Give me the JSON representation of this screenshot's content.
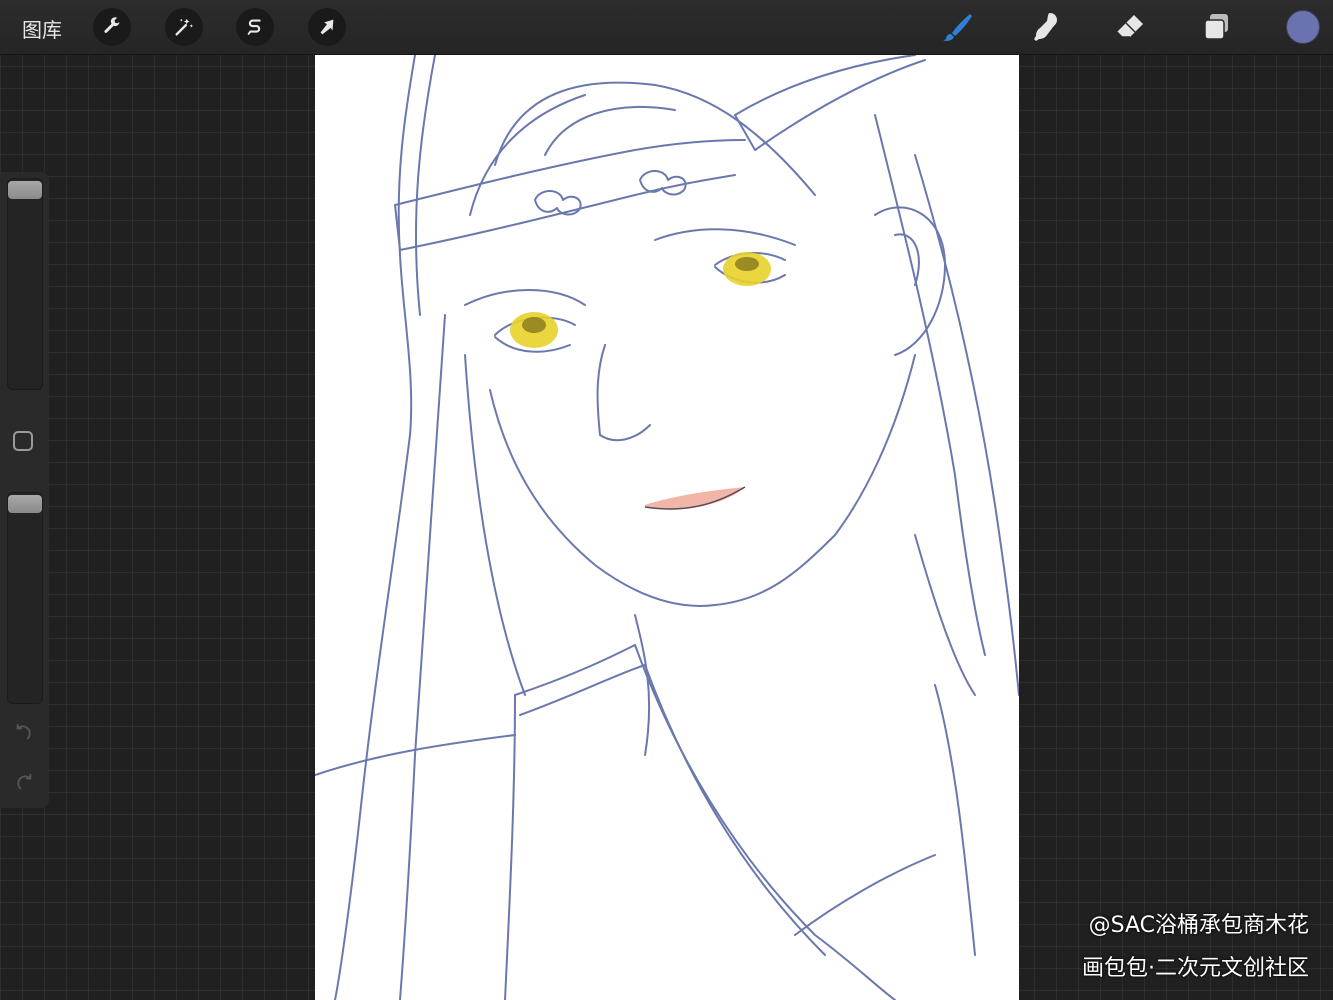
{
  "topbar": {
    "gallery_label": "图库",
    "left_tools": [
      {
        "name": "actions",
        "icon": "wrench-icon"
      },
      {
        "name": "adjustments",
        "icon": "magic-wand-icon"
      },
      {
        "name": "selection",
        "icon": "selection-s-icon"
      },
      {
        "name": "transform",
        "icon": "arrow-cursor-icon"
      }
    ],
    "right_tools": [
      {
        "name": "brush",
        "icon": "brush-icon",
        "active": true
      },
      {
        "name": "smudge",
        "icon": "smudge-finger-icon"
      },
      {
        "name": "eraser",
        "icon": "eraser-icon"
      },
      {
        "name": "layers",
        "icon": "layers-icon"
      }
    ],
    "current_color": "#6a73ad",
    "active_tool_color": "#2f7fd8"
  },
  "sidebar": {
    "brush_size_level": 0.0,
    "opacity_level": 0.0,
    "undo_icon": "undo-icon",
    "redo_icon": "redo-icon"
  },
  "canvas": {
    "stroke_color": "#5a6aa5",
    "eye_color": "#e8d12a",
    "lip_color": "#f0a99a"
  },
  "watermark": {
    "line1": "@SAC浴桶承包商木花",
    "line2": "画包包·二次元文创社区"
  }
}
